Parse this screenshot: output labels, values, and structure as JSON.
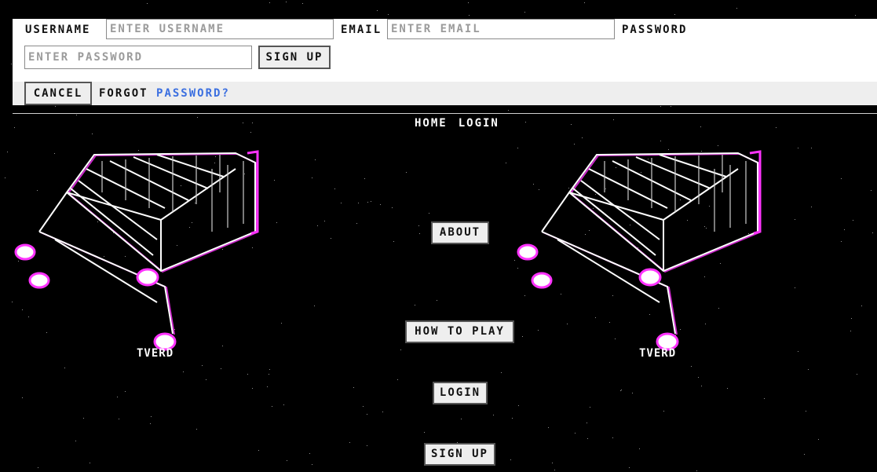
{
  "signup": {
    "username_label": "USERNAME",
    "username_placeholder": "ENTER USERNAME",
    "email_label": "EMAIL",
    "email_placeholder": "ENTER EMAIL",
    "password_label": "PASSWORD",
    "password_placeholder": "ENTER PASSWORD",
    "submit_label": "SIGN UP"
  },
  "footer": {
    "cancel_label": "CANCEL",
    "forgot_prefix": "FORGOT",
    "forgot_link": "PASSWORD?"
  },
  "nav": {
    "items": [
      {
        "label": "HOME"
      },
      {
        "label": "LOGIN"
      }
    ]
  },
  "menu": {
    "about": "ABOUT",
    "how_to_play": "HOW TO PLAY",
    "login": "LOGIN",
    "sign_up": "SIGN UP"
  },
  "carts": {
    "left_caption": "TVERD",
    "right_caption": "TVERD"
  },
  "colors": {
    "background": "#000000",
    "panel": "#ffffff",
    "button": "#eeeeee",
    "link": "#3b6fe0",
    "cart_accent": "#ff33ff"
  }
}
